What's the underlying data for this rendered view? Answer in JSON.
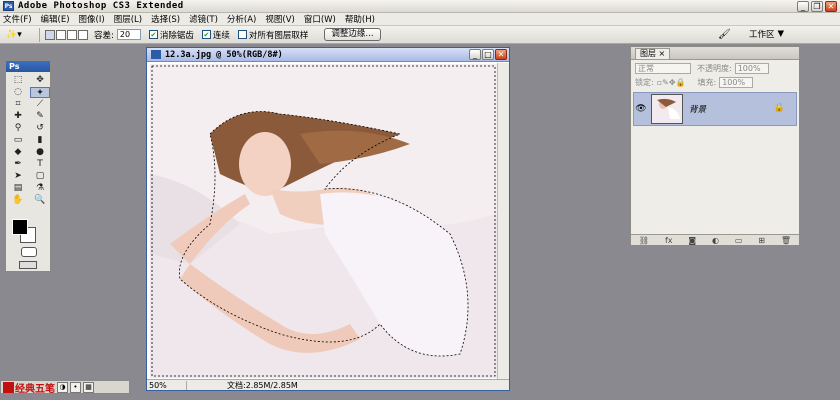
{
  "app": {
    "title": "Adobe Photoshop CS3 Extended",
    "logo": "Ps"
  },
  "menu": [
    "文件(F)",
    "编辑(E)",
    "图像(I)",
    "图层(L)",
    "选择(S)",
    "滤镜(T)",
    "分析(A)",
    "视图(V)",
    "窗口(W)",
    "帮助(H)"
  ],
  "options": {
    "tolerance_label": "容差:",
    "tolerance_value": "20",
    "antialias_label": "消除锯齿",
    "contiguous_label": "连续",
    "sample_all_label": "对所有图层取样",
    "refine_edge_label": "调整边缘...",
    "workspace_label": "工作区"
  },
  "toolbox": {
    "title": "Ps"
  },
  "document": {
    "title": "12.3a.jpg @ 50%(RGB/8#)",
    "zoom": "50%",
    "doc_size": "文档:2.85M/2.85M"
  },
  "layers_panel": {
    "tab": "图层",
    "blend_mode": "正常",
    "opacity_label": "不透明度:",
    "opacity_value": "100%",
    "lock_label": "锁定:",
    "fill_label": "填充:",
    "fill_value": "100%",
    "layer_name": "背景"
  },
  "ime": {
    "label": "经典五笔"
  }
}
